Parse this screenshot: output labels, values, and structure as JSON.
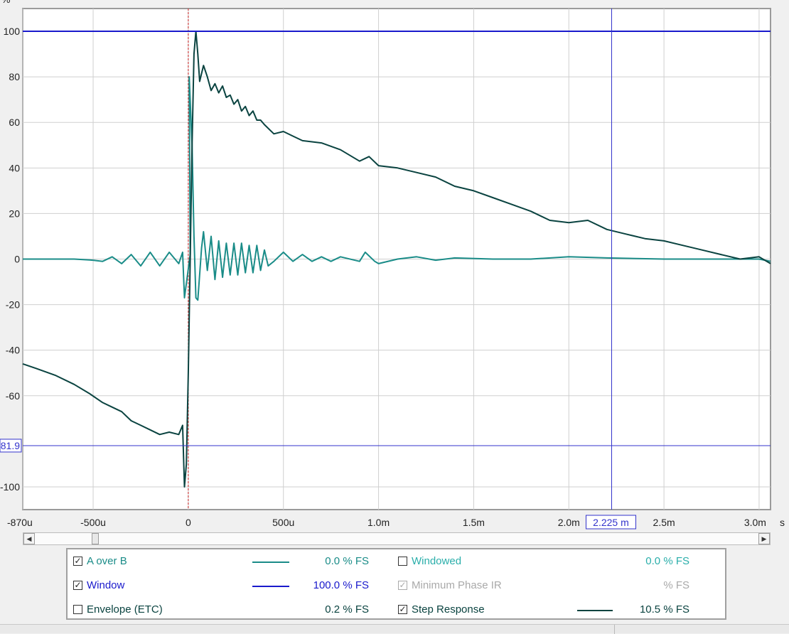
{
  "chart_data": {
    "type": "line",
    "ylabel": "%",
    "xunit": "s",
    "xlim": [
      -0.00087,
      0.00306
    ],
    "ylim": [
      -110,
      110
    ],
    "x_ticks": [
      {
        "v": -0.00087,
        "label": "-870u"
      },
      {
        "v": -0.0005,
        "label": "-500u"
      },
      {
        "v": 0,
        "label": "0"
      },
      {
        "v": 0.0005,
        "label": "500u"
      },
      {
        "v": 0.001,
        "label": "1.0m"
      },
      {
        "v": 0.0015,
        "label": "1.5m"
      },
      {
        "v": 0.002,
        "label": "2.0m"
      },
      {
        "v": 0.0025,
        "label": "2.5m"
      },
      {
        "v": 0.003,
        "label": "3.0m"
      }
    ],
    "y_ticks": [
      100,
      80,
      60,
      40,
      20,
      0,
      -20,
      -40,
      -60,
      -100
    ],
    "grid": true,
    "cursor": {
      "x": 0.002225,
      "x_label": "2.225 m",
      "y": -81.9,
      "y_label": "81.9"
    },
    "window_level": 100,
    "reference_x": 0,
    "series": [
      {
        "name": "A over B",
        "color": "#1a8c88",
        "points": [
          [
            -0.00087,
            0
          ],
          [
            -0.0006,
            0
          ],
          [
            -0.0005,
            -0.5
          ],
          [
            -0.00045,
            -1
          ],
          [
            -0.0004,
            1
          ],
          [
            -0.00035,
            -2
          ],
          [
            -0.0003,
            2
          ],
          [
            -0.00025,
            -3
          ],
          [
            -0.0002,
            3
          ],
          [
            -0.00015,
            -3
          ],
          [
            -0.0001,
            3
          ],
          [
            -5e-05,
            -2
          ],
          [
            -3e-05,
            3
          ],
          [
            -2e-05,
            -17
          ],
          [
            1e-05,
            2
          ],
          [
            5e-06,
            80
          ],
          [
            2e-05,
            50
          ],
          [
            3e-05,
            10
          ],
          [
            4e-05,
            -17
          ],
          [
            5e-05,
            -18
          ],
          [
            7e-05,
            5
          ],
          [
            8e-05,
            12
          ],
          [
            0.0001,
            -5
          ],
          [
            0.00012,
            10
          ],
          [
            0.00014,
            -9
          ],
          [
            0.00016,
            8
          ],
          [
            0.00018,
            -8
          ],
          [
            0.0002,
            7
          ],
          [
            0.00022,
            -7
          ],
          [
            0.00024,
            7
          ],
          [
            0.00026,
            -7
          ],
          [
            0.00028,
            7
          ],
          [
            0.0003,
            -6
          ],
          [
            0.00032,
            6
          ],
          [
            0.00034,
            -6
          ],
          [
            0.00036,
            6
          ],
          [
            0.00038,
            -5
          ],
          [
            0.0004,
            4
          ],
          [
            0.00042,
            -3
          ],
          [
            0.00045,
            -1
          ],
          [
            0.0005,
            3
          ],
          [
            0.00055,
            -1
          ],
          [
            0.0006,
            2
          ],
          [
            0.00065,
            -1
          ],
          [
            0.0007,
            1
          ],
          [
            0.00075,
            -1
          ],
          [
            0.0008,
            1
          ],
          [
            0.0009,
            -1
          ],
          [
            0.00093,
            3
          ],
          [
            0.00098,
            -1
          ],
          [
            0.001,
            -2
          ],
          [
            0.0011,
            0
          ],
          [
            0.0012,
            1
          ],
          [
            0.0013,
            -0.5
          ],
          [
            0.0014,
            0.5
          ],
          [
            0.0016,
            0
          ],
          [
            0.0018,
            0
          ],
          [
            0.002,
            1
          ],
          [
            0.0022,
            0.5
          ],
          [
            0.0025,
            0
          ],
          [
            0.0028,
            0
          ],
          [
            0.003,
            0
          ],
          [
            0.00306,
            -1
          ]
        ]
      },
      {
        "name": "Step Response",
        "color": "#0a4340",
        "points": [
          [
            -0.00087,
            -46
          ],
          [
            -0.0008,
            -48
          ],
          [
            -0.0007,
            -51
          ],
          [
            -0.0006,
            -55
          ],
          [
            -0.00052,
            -59
          ],
          [
            -0.00045,
            -63
          ],
          [
            -0.0004,
            -65
          ],
          [
            -0.00035,
            -67
          ],
          [
            -0.0003,
            -71
          ],
          [
            -0.00025,
            -73
          ],
          [
            -0.0002,
            -75
          ],
          [
            -0.00015,
            -77
          ],
          [
            -0.0001,
            -76
          ],
          [
            -5e-05,
            -77
          ],
          [
            -3e-05,
            -73
          ],
          [
            -2e-05,
            -100
          ],
          [
            -1e-05,
            -90
          ],
          [
            0,
            -50
          ],
          [
            1e-05,
            0
          ],
          [
            2e-05,
            50
          ],
          [
            3e-05,
            90
          ],
          [
            4e-05,
            100
          ],
          [
            5e-05,
            90
          ],
          [
            6e-05,
            78
          ],
          [
            8e-05,
            85
          ],
          [
            0.0001,
            80
          ],
          [
            0.00012,
            74
          ],
          [
            0.00014,
            77
          ],
          [
            0.00016,
            73
          ],
          [
            0.00018,
            76
          ],
          [
            0.0002,
            71
          ],
          [
            0.00022,
            72
          ],
          [
            0.00024,
            68
          ],
          [
            0.00026,
            70
          ],
          [
            0.00028,
            65
          ],
          [
            0.0003,
            67
          ],
          [
            0.00032,
            63
          ],
          [
            0.00034,
            65
          ],
          [
            0.00036,
            61
          ],
          [
            0.00038,
            61
          ],
          [
            0.0004,
            59
          ],
          [
            0.00045,
            55
          ],
          [
            0.0005,
            56
          ],
          [
            0.00055,
            54
          ],
          [
            0.0006,
            52
          ],
          [
            0.0007,
            51
          ],
          [
            0.0008,
            48
          ],
          [
            0.0009,
            43
          ],
          [
            0.00095,
            45
          ],
          [
            0.001,
            41
          ],
          [
            0.0011,
            40
          ],
          [
            0.0012,
            38
          ],
          [
            0.0013,
            36
          ],
          [
            0.0014,
            32
          ],
          [
            0.0015,
            30
          ],
          [
            0.0016,
            27
          ],
          [
            0.0017,
            24
          ],
          [
            0.0018,
            21
          ],
          [
            0.0019,
            17
          ],
          [
            0.002,
            16
          ],
          [
            0.0021,
            17
          ],
          [
            0.0022,
            13
          ],
          [
            0.0023,
            11
          ],
          [
            0.0024,
            9
          ],
          [
            0.0025,
            8
          ],
          [
            0.0026,
            6
          ],
          [
            0.0027,
            4
          ],
          [
            0.0028,
            2
          ],
          [
            0.0029,
            0
          ],
          [
            0.003,
            1
          ],
          [
            0.00306,
            -2
          ]
        ]
      },
      {
        "name": "Window",
        "color": "#1a1acc",
        "points": [
          [
            -0.00087,
            100
          ],
          [
            0.00306,
            100
          ]
        ]
      }
    ]
  },
  "legend": {
    "items": [
      {
        "label": "A over B",
        "checked": true,
        "value": "0.0 % FS",
        "color": "#1a8c88",
        "swatch": true
      },
      {
        "label": "Windowed",
        "checked": false,
        "value": "0.0 % FS",
        "color": "#2aaeaa",
        "swatch": false
      },
      {
        "label": "Window",
        "checked": true,
        "value": "100.0 % FS",
        "color": "#1a1acc",
        "swatch": true
      },
      {
        "label": "Minimum Phase IR",
        "checked": true,
        "disabled": true,
        "value": "% FS",
        "color": "#a9a9a9",
        "swatch": false
      },
      {
        "label": "Envelope (ETC)",
        "checked": false,
        "value": "0.2 % FS",
        "color": "#0a4340",
        "swatch": false
      },
      {
        "label": "Step Response",
        "checked": true,
        "value": "10.5 % FS",
        "color": "#0a4340",
        "swatch": true
      }
    ]
  },
  "colors": {
    "grid": "#cfcfcf",
    "cursor": "#3333cc",
    "reference": "#cc2222"
  }
}
